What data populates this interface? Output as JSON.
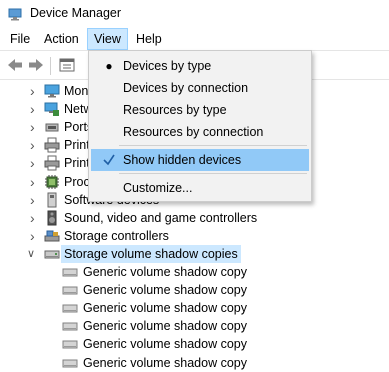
{
  "window": {
    "title": "Device Manager"
  },
  "menubar": {
    "items": [
      "File",
      "Action",
      "View",
      "Help"
    ]
  },
  "view_menu": {
    "items": [
      {
        "label": "Devices by type",
        "mark": "bullet"
      },
      {
        "label": "Devices by connection",
        "mark": ""
      },
      {
        "label": "Resources by type",
        "mark": ""
      },
      {
        "label": "Resources by connection",
        "mark": ""
      },
      {
        "label": "Show hidden devices",
        "mark": "check",
        "highlighted": true
      },
      {
        "label": "Customize...",
        "mark": ""
      }
    ]
  },
  "tree": {
    "items": [
      {
        "label": "Monitors",
        "icon": "monitor-icon"
      },
      {
        "label": "Network adapters",
        "icon": "network-adapter-icon"
      },
      {
        "label": "Ports (COM & LPT)",
        "icon": "port-icon"
      },
      {
        "label": "Print queues",
        "icon": "printer-icon"
      },
      {
        "label": "Printers",
        "icon": "printer-icon"
      },
      {
        "label": "Processors",
        "icon": "processor-icon"
      },
      {
        "label": "Software devices",
        "icon": "software-device-icon"
      },
      {
        "label": "Sound, video and game controllers",
        "icon": "speaker-icon"
      },
      {
        "label": "Storage controllers",
        "icon": "storage-controller-icon"
      },
      {
        "label": "Storage volume shadow copies",
        "icon": "drive-icon",
        "expanded": true,
        "selected": true
      }
    ],
    "children": [
      "Generic volume shadow copy",
      "Generic volume shadow copy",
      "Generic volume shadow copy",
      "Generic volume shadow copy",
      "Generic volume shadow copy",
      "Generic volume shadow copy"
    ]
  }
}
